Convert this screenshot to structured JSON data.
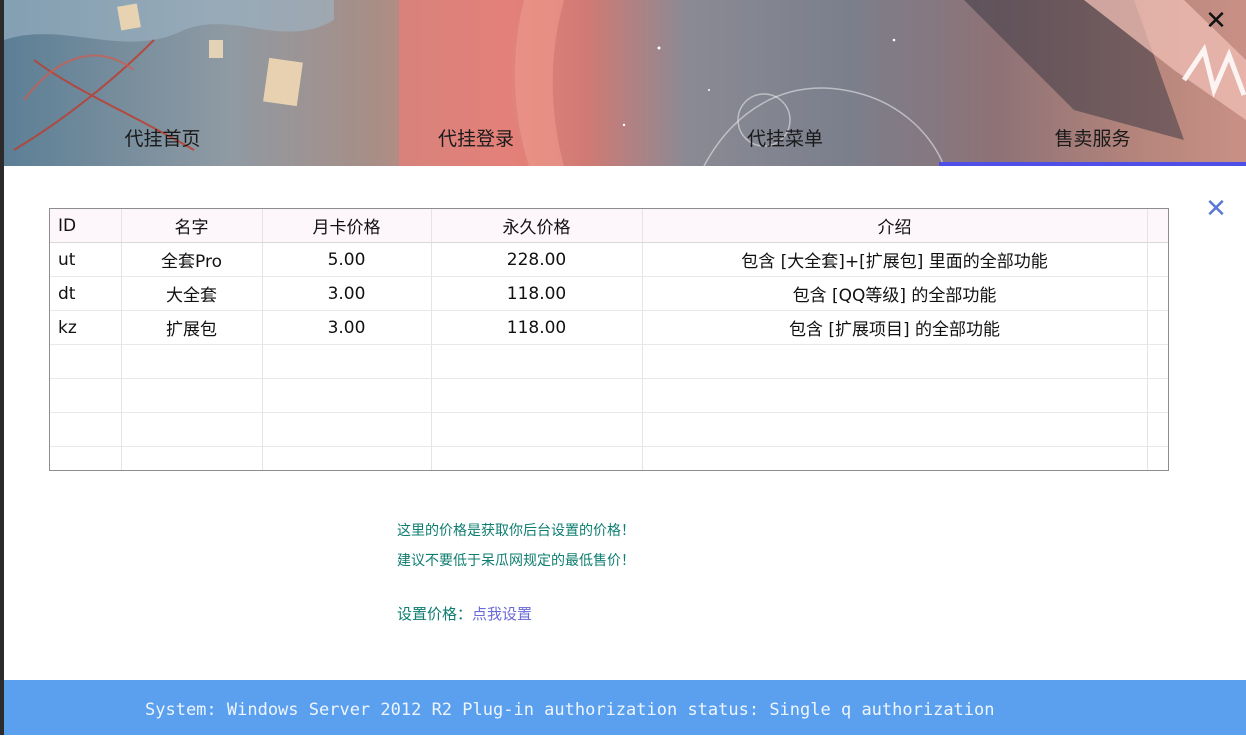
{
  "window": {
    "close_glyph": "✕"
  },
  "nav": {
    "tabs": [
      {
        "label": "代挂首页"
      },
      {
        "label": "代挂登录"
      },
      {
        "label": "代挂菜单"
      },
      {
        "label": "售卖服务"
      }
    ],
    "active_index": 3
  },
  "panel": {
    "close_glyph": "✕"
  },
  "table": {
    "headers": [
      "ID",
      "名字",
      "月卡价格",
      "永久价格",
      "介绍"
    ],
    "rows": [
      {
        "id": "ut",
        "name": "全套Pro",
        "monthly": "5.00",
        "permanent": "228.00",
        "intro": "包含 [大全套]+[扩展包] 里面的全部功能"
      },
      {
        "id": "dt",
        "name": "大全套",
        "monthly": "3.00",
        "permanent": "118.00",
        "intro": "包含 [QQ等级] 的全部功能"
      },
      {
        "id": "kz",
        "name": "扩展包",
        "monthly": "3.00",
        "permanent": "118.00",
        "intro": "包含 [扩展项目] 的全部功能"
      }
    ]
  },
  "notes": {
    "line1": "这里的价格是获取你后台设置的价格！",
    "line2": "建议不要低于呆瓜网规定的最低售价！",
    "set_label": "设置价格：",
    "set_link": "点我设置"
  },
  "status_bar": {
    "text": "System:  Windows Server 2012 R2  Plug-in authorization status:  Single q authorization"
  },
  "colors": {
    "accent_underline": "#4f4fe8",
    "note_text": "#0d7d70",
    "link": "#6a6ad8",
    "status_bar": "#5aa0ef"
  },
  "icons": {
    "window_close": "close-icon",
    "panel_close": "close-icon"
  }
}
